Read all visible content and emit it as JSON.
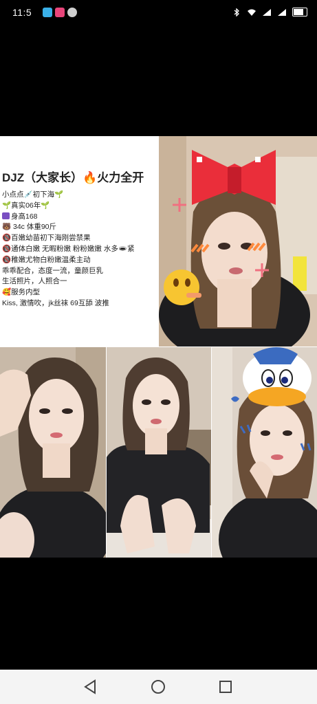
{
  "status_bar": {
    "time": "11:5",
    "app_icons": [
      "reader-app-icon",
      "video-app-icon",
      "chat-app-icon"
    ],
    "right_icons": [
      "bluetooth-icon",
      "wifi-icon",
      "signal-icon",
      "signal-icon",
      "battery-icon"
    ]
  },
  "post": {
    "title": "DJZ（大家长）🔥火力全开",
    "lines": [
      "小点点💉初下海🌱",
      "🌱真实06年🌱",
      "身高168",
      "🐻  34c    体重90斤",
      "🔞百嫩幼苗初下海刚尝禁果",
      "🔞通体白嫩 无暇粉嫩  粉粉嫩嫩   水多🕳紧",
      "🔞稚嫩尤物白粉嫩温柔主动",
      "乖乖配合，态度一流，童颜巨乳",
      " 生活照片，人照合一",
      "🥰服务内型",
      "Kiss,     激情吹，jk丝袜  69互舔   波推"
    ]
  },
  "photos": [
    {
      "name": "photo-bow-sticker",
      "alt": "girl with pixel bow sticker"
    },
    {
      "name": "photo-hand-on-head",
      "alt": "girl with hand on head"
    },
    {
      "name": "photo-sitting",
      "alt": "girl sitting"
    },
    {
      "name": "photo-duck-sticker",
      "alt": "girl with duck sticker"
    }
  ],
  "nav_bar": {
    "buttons": [
      "back-button",
      "home-button",
      "recents-button"
    ]
  },
  "colors": {
    "background": "#000000",
    "panel": "#ffffff",
    "nav": "#f4f4f4"
  }
}
